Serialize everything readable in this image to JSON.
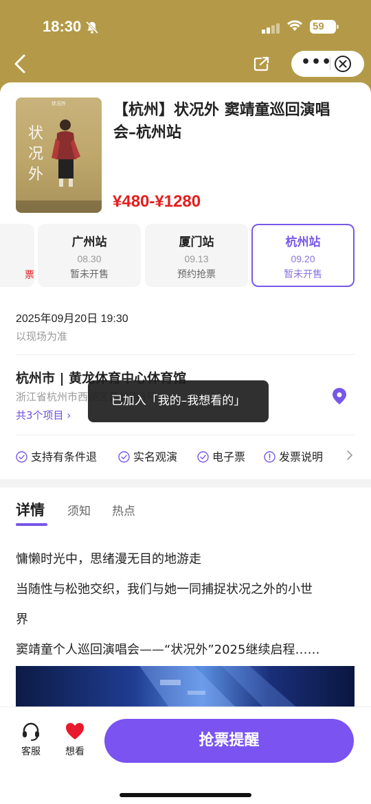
{
  "status_bar": {
    "time": "18:30",
    "battery": "59",
    "icons": [
      "bell-muted-icon",
      "signal-icon",
      "wifi-icon",
      "battery-icon"
    ]
  },
  "nav": {
    "back_icon": "chevron-left-icon",
    "share_icon": "share-icon",
    "more_label": "•••",
    "close_icon": "close-circle-icon"
  },
  "event": {
    "title": "【杭州】状况外 窦靖童巡回演唱会–杭州站",
    "price": "¥480-¥1280",
    "poster": {
      "caption": "状况外",
      "chars": [
        "状",
        "况",
        "外"
      ]
    }
  },
  "stations": [
    {
      "name": "",
      "date": "",
      "status": "",
      "partial_mark": "票"
    },
    {
      "name": "广州站",
      "date": "08.30",
      "status": "暂未开售"
    },
    {
      "name": "厦门站",
      "date": "09.13",
      "status": "预约抢票"
    },
    {
      "name": "杭州站",
      "date": "09.20",
      "status": "暂未开售",
      "selected": true
    }
  ],
  "schedule": {
    "datetime": "2025年09月20日 19:30",
    "note": "以现场为准"
  },
  "venue": {
    "name": "杭州市 | 黄龙体育中心体育馆",
    "address": "浙江省杭州市西湖区黄龙路3号",
    "projects_link": "共3个项目 ›"
  },
  "features": [
    {
      "label": "支持有条件退",
      "icon": "check-circle-icon"
    },
    {
      "label": "实名观演",
      "icon": "check-circle-icon"
    },
    {
      "label": "电子票",
      "icon": "check-circle-icon"
    },
    {
      "label": "发票说明",
      "icon": "info-circle-icon"
    }
  ],
  "tabs": [
    {
      "label": "详情",
      "active": true
    },
    {
      "label": "须知"
    },
    {
      "label": "热点"
    }
  ],
  "details": {
    "line1": "慵懒时光中，思绪漫无目的地游走",
    "line2a": "当随性与松弛交织，我们与她一同捕捉状况之外的小世",
    "line2b": "界",
    "line3": "窦靖童个人巡回演唱会——“状况外”2025继续启程……"
  },
  "toast": "已加入「我的–我想看的」",
  "bottom_bar": {
    "service_label": "客服",
    "want_label": "想看",
    "remind_button": "抢票提醒",
    "colors": {
      "accent": "#7a53f0",
      "heart": "#e8192c"
    }
  }
}
